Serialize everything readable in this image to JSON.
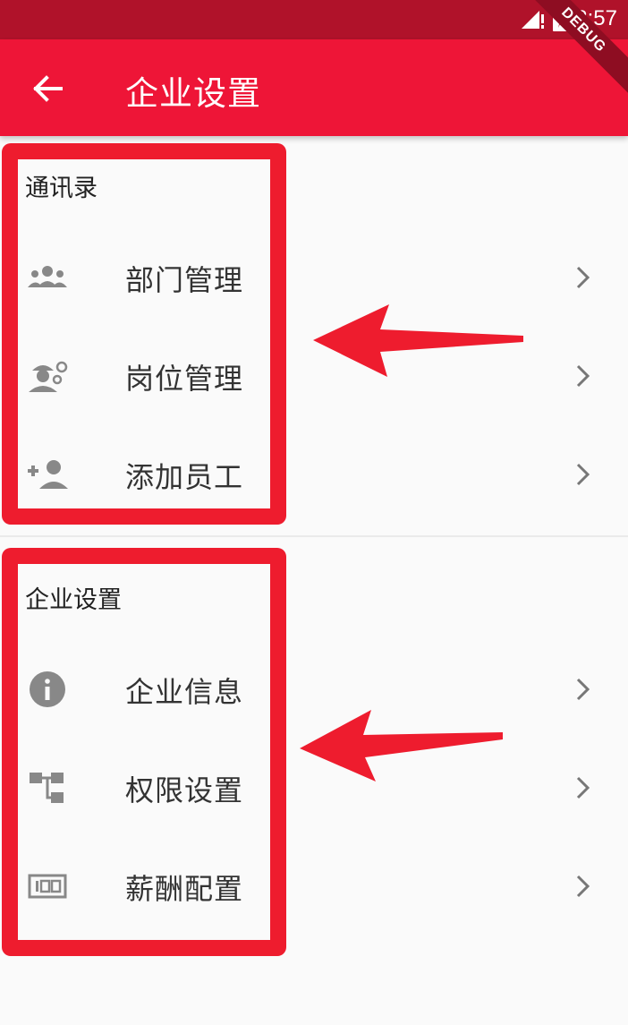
{
  "status_bar": {
    "time": "8:57"
  },
  "debug_banner": "DEBUG",
  "app_bar": {
    "title": "企业设置",
    "back_icon": "arrow-back-icon"
  },
  "sections": [
    {
      "header": "通讯录",
      "items": [
        {
          "label": "部门管理",
          "icon": "group-icon"
        },
        {
          "label": "岗位管理",
          "icon": "engineer-icon"
        },
        {
          "label": "添加员工",
          "icon": "person-add-icon"
        }
      ]
    },
    {
      "header": "企业设置",
      "items": [
        {
          "label": "企业信息",
          "icon": "info-icon"
        },
        {
          "label": "权限设置",
          "icon": "hierarchy-icon"
        },
        {
          "label": "薪酬配置",
          "icon": "counter-icon"
        }
      ]
    }
  ],
  "colors": {
    "primary": "#ee1537",
    "status_bar": "#b0122a",
    "annotation": "#ee1c2e",
    "icon_grey": "#888888",
    "background": "#fafafa"
  }
}
